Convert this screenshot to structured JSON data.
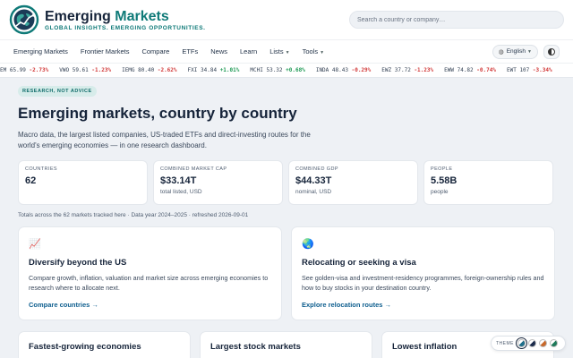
{
  "brand": {
    "name_part1": "Emerging",
    "name_part2": "Markets",
    "tagline": "GLOBAL INSIGHTS. EMERGING OPPORTUNITIES.",
    "logo_icon": "globe-chart-icon"
  },
  "search": {
    "placeholder": "Search a country or company…"
  },
  "nav": {
    "items": [
      {
        "label": "Emerging Markets"
      },
      {
        "label": "Frontier Markets"
      },
      {
        "label": "Compare"
      },
      {
        "label": "ETFs"
      },
      {
        "label": "News"
      },
      {
        "label": "Learn"
      },
      {
        "label": "Lists",
        "has_caret": true
      },
      {
        "label": "Tools",
        "has_caret": true
      }
    ],
    "language": "English"
  },
  "ticker": [
    {
      "symbol": "EM",
      "price": "65.99",
      "change": "-2.73%"
    },
    {
      "symbol": "VWO",
      "price": "59.61",
      "change": "-1.23%"
    },
    {
      "symbol": "IEMG",
      "price": "80.40",
      "change": "-2.62%"
    },
    {
      "symbol": "FXI",
      "price": "34.84",
      "change": "+1.01%"
    },
    {
      "symbol": "MCHI",
      "price": "53.32",
      "change": "+0.68%"
    },
    {
      "symbol": "INDA",
      "price": "48.43",
      "change": "-0.29%"
    },
    {
      "symbol": "EWZ",
      "price": "37.72",
      "change": "-1.23%"
    },
    {
      "symbol": "EWW",
      "price": "74.82",
      "change": "-0.74%"
    },
    {
      "symbol": "EWT",
      "price": "107",
      "change": "-3.34%"
    }
  ],
  "hero": {
    "badge": "RESEARCH, NOT ADVICE",
    "title": "Emerging markets, country by country",
    "lead": "Macro data, the largest listed companies, US-traded ETFs and direct-investing routes for the world's emerging economies — in one research dashboard."
  },
  "stats": [
    {
      "label": "COUNTRIES",
      "value": "62",
      "sub": ""
    },
    {
      "label": "COMBINED MARKET CAP",
      "value": "$33.14T",
      "sub": "total listed, USD"
    },
    {
      "label": "COMBINED GDP",
      "value": "$44.33T",
      "sub": "nominal, USD"
    },
    {
      "label": "PEOPLE",
      "value": "5.58B",
      "sub": "people"
    }
  ],
  "stats_note": "Totals across the 62 markets tracked here · Data year 2024–2025 · refreshed 2026-09-01",
  "cards": [
    {
      "icon": "📈",
      "title": "Diversify beyond the US",
      "desc": "Compare growth, inflation, valuation and market size across emerging economies to research where to allocate next.",
      "link": "Compare countries →"
    },
    {
      "icon": "🌏",
      "title": "Relocating or seeking a visa",
      "desc": "See golden-visa and investment-residency programmes, foreign-ownership rules and how to buy stocks in your destination country.",
      "link": "Explore relocation routes →"
    }
  ],
  "lists": [
    {
      "title": "Fastest-growing economies"
    },
    {
      "title": "Largest stock markets"
    },
    {
      "title": "Lowest inflation"
    }
  ],
  "theme_picker": {
    "label": "THEME",
    "swatches": [
      "#1f6f8b",
      "#1c2c4c",
      "#c8692c",
      "#1f7a5a"
    ]
  },
  "colors": {
    "accent": "#0f7a78",
    "link": "#0f5f8f",
    "negative": "#d23b3b",
    "positive": "#1f9a55"
  }
}
